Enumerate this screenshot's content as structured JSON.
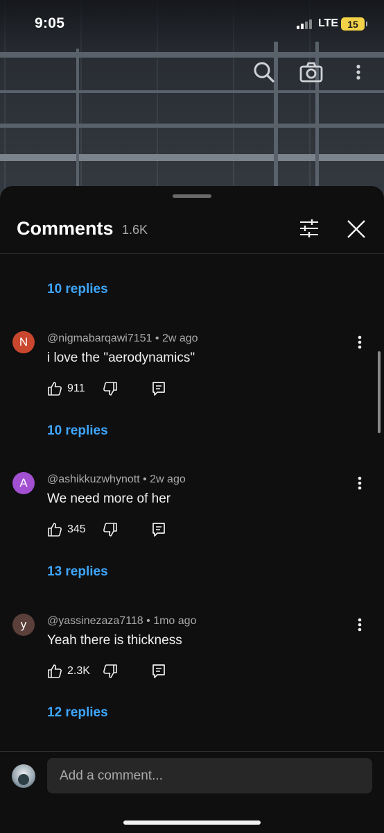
{
  "status": {
    "time": "9:05",
    "network": "LTE",
    "battery": "15"
  },
  "header": {
    "title": "Comments",
    "count": "1.6K"
  },
  "first_replies": "10 replies",
  "comments": [
    {
      "avatar_letter": "N",
      "avatar_color": "#c9472e",
      "author": "@nigmabarqawi7151",
      "age": "2w ago",
      "text": "i love the \"aerodynamics\"",
      "likes": "911",
      "replies": "10 replies"
    },
    {
      "avatar_letter": "A",
      "avatar_color": "#a24fd1",
      "author": "@ashikkuzwhynott",
      "age": "2w ago",
      "text": "We need more of her",
      "likes": "345",
      "replies": "13 replies"
    },
    {
      "avatar_letter": "y",
      "avatar_color": "#5b3f3a",
      "author": "@yassinezaza7118",
      "age": "1mo ago",
      "text": "Yeah there is thickness",
      "likes": "2.3K",
      "replies": "12 replies"
    }
  ],
  "composer": {
    "placeholder": "Add a comment..."
  },
  "colors": {
    "link": "#3ea6ff",
    "background": "#0f0f0f",
    "input": "#272727"
  },
  "icons": [
    "search-icon",
    "camera-icon",
    "more-vert-icon",
    "filter-icon",
    "close-icon",
    "like-icon",
    "dislike-icon",
    "reply-icon"
  ]
}
